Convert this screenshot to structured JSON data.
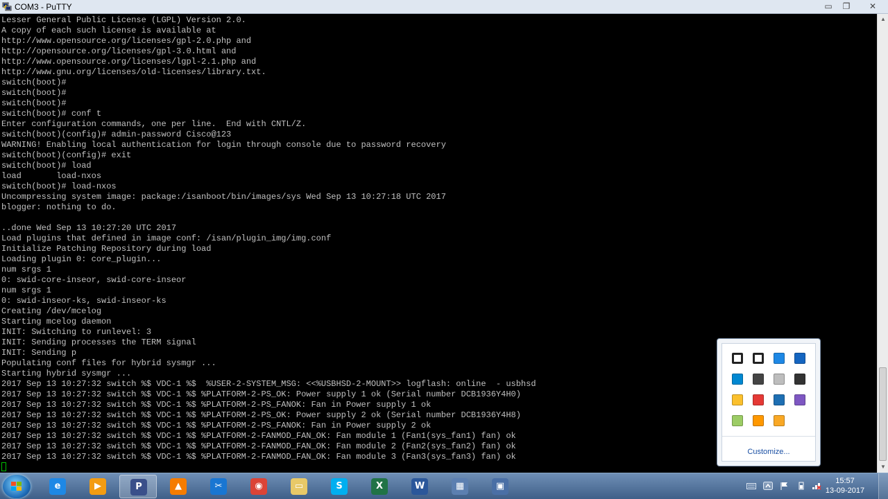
{
  "window": {
    "title": "COM3 - PuTTY",
    "buttons": {
      "minimize": "▭",
      "maximize": "❐",
      "close": "✕"
    }
  },
  "terminal": {
    "lines": [
      "Lesser General Public License (LGPL) Version 2.0.",
      "A copy of each such license is available at",
      "http://www.opensource.org/licenses/gpl-2.0.php and",
      "http://opensource.org/licenses/gpl-3.0.html and",
      "http://www.opensource.org/licenses/lgpl-2.1.php and",
      "http://www.gnu.org/licenses/old-licenses/library.txt.",
      "switch(boot)#",
      "switch(boot)#",
      "switch(boot)#",
      "switch(boot)# conf t",
      "Enter configuration commands, one per line.  End with CNTL/Z.",
      "switch(boot)(config)# admin-password Cisco@123",
      "WARNING! Enabling local authentication for login through console due to password recovery",
      "switch(boot)(config)# exit",
      "switch(boot)# load",
      "load       load-nxos",
      "switch(boot)# load-nxos",
      "Uncompressing system image: package:/isanboot/bin/images/sys Wed Sep 13 10:27:18 UTC 2017",
      "blogger: nothing to do.",
      "",
      "..done Wed Sep 13 10:27:20 UTC 2017",
      "Load plugins that defined in image conf: /isan/plugin_img/img.conf",
      "Initialize Patching Repository during load",
      "Loading plugin 0: core_plugin...",
      "num srgs 1",
      "0: swid-core-inseor, swid-core-inseor",
      "num srgs 1",
      "0: swid-inseor-ks, swid-inseor-ks",
      "Creating /dev/mcelog",
      "Starting mcelog daemon",
      "INIT: Switching to runlevel: 3",
      "INIT: Sending processes the TERM signal",
      "INIT: Sending p",
      "Populating conf files for hybrid sysmgr ...",
      "Starting hybrid sysmgr ...",
      "2017 Sep 13 10:27:32 switch %$ VDC-1 %$  %USER-2-SYSTEM_MSG: <<%USBHSD-2-MOUNT>> logflash: online  - usbhsd",
      "2017 Sep 13 10:27:32 switch %$ VDC-1 %$ %PLATFORM-2-PS_OK: Power supply 1 ok (Serial number DCB1936Y4H0)",
      "2017 Sep 13 10:27:32 switch %$ VDC-1 %$ %PLATFORM-2-PS_FANOK: Fan in Power supply 1 ok",
      "2017 Sep 13 10:27:32 switch %$ VDC-1 %$ %PLATFORM-2-PS_OK: Power supply 2 ok (Serial number DCB1936Y4H8)",
      "2017 Sep 13 10:27:32 switch %$ VDC-1 %$ %PLATFORM-2-PS_FANOK: Fan in Power supply 2 ok",
      "2017 Sep 13 10:27:32 switch %$ VDC-1 %$ %PLATFORM-2-FANMOD_FAN_OK: Fan module 1 (Fan1(sys_fan1) fan) ok",
      "2017 Sep 13 10:27:32 switch %$ VDC-1 %$ %PLATFORM-2-FANMOD_FAN_OK: Fan module 2 (Fan2(sys_fan2) fan) ok",
      "2017 Sep 13 10:27:32 switch %$ VDC-1 %$ %PLATFORM-2-FANMOD_FAN_OK: Fan module 3 (Fan3(sys_fan3) fan) ok"
    ],
    "text_color": "#c0c0c0",
    "cursor_color": "#00c000"
  },
  "tray_popup": {
    "icons": [
      "stop-icon",
      "pause-icon",
      "shield-icon",
      "network-monitor-icon",
      "sync-icon",
      "display-icon",
      "disk-icon",
      "target-icon",
      "remote-desktop-icon",
      "blocked-icon",
      "globe-icon",
      "onenote-icon",
      "leaf-icon",
      "cloud-icon",
      "security-icon"
    ],
    "customize_label": "Customize..."
  },
  "taskbar": {
    "pinned": [
      {
        "name": "internet-explorer-icon",
        "glyph": "e",
        "color": "#1e88e5"
      },
      {
        "name": "media-player-icon",
        "glyph": "▶",
        "color": "#f39c12"
      },
      {
        "name": "putty-icon",
        "glyph": "P",
        "color": "#3a4f8a",
        "active": true
      },
      {
        "name": "vlc-icon",
        "glyph": "▲",
        "color": "#f57c00"
      },
      {
        "name": "snipping-tool-icon",
        "glyph": "✂",
        "color": "#1976d2"
      },
      {
        "name": "chrome-icon",
        "glyph": "◉",
        "color": "#db4437"
      },
      {
        "name": "folder-icon",
        "glyph": "▭",
        "color": "#e8c968"
      },
      {
        "name": "skype-icon",
        "glyph": "S",
        "color": "#00aff0"
      },
      {
        "name": "excel-icon",
        "glyph": "X",
        "color": "#217346"
      },
      {
        "name": "word-icon",
        "glyph": "W",
        "color": "#2b579a"
      },
      {
        "name": "control-panel-icon",
        "glyph": "▦",
        "color": "#5c7fb0"
      },
      {
        "name": "remote-desktop-icon",
        "glyph": "▣",
        "color": "#4a6fa5"
      }
    ],
    "clock": {
      "time": "15:57",
      "date": "13-09-2017"
    }
  }
}
